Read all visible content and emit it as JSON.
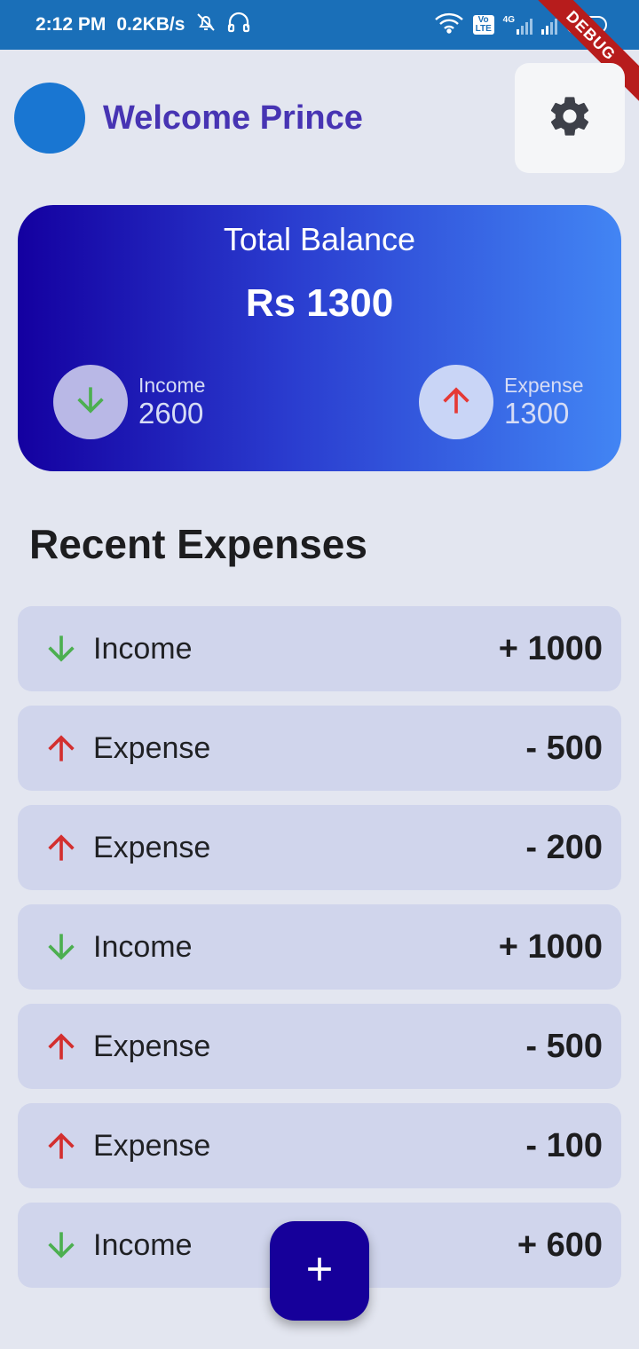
{
  "status_bar": {
    "time": "2:12 PM",
    "speed": "0.2KB/s",
    "battery": "63",
    "network_label": "4G",
    "volte_label": "Vo LTE",
    "debug_label": "DEBUG"
  },
  "header": {
    "welcome": "Welcome Prince",
    "avatar_color": "#1976d2",
    "settings_icon": "gear-icon"
  },
  "balance": {
    "title": "Total Balance",
    "amount": "Rs 1300",
    "income_label": "Income",
    "income_value": "2600",
    "expense_label": "Expense",
    "expense_value": "1300"
  },
  "recent": {
    "heading": "Recent Expenses",
    "items": [
      {
        "type": "income",
        "label": "Income",
        "amount": "+ 1000"
      },
      {
        "type": "expense",
        "label": "Expense",
        "amount": "- 500"
      },
      {
        "type": "expense",
        "label": "Expense",
        "amount": "- 200"
      },
      {
        "type": "income",
        "label": "Income",
        "amount": "+ 1000"
      },
      {
        "type": "expense",
        "label": "Expense",
        "amount": "- 500"
      },
      {
        "type": "expense",
        "label": "Expense",
        "amount": "- 100"
      },
      {
        "type": "income",
        "label": "Income",
        "amount": "+ 600"
      }
    ]
  },
  "colors": {
    "income_green": "#4caf50",
    "expense_red": "#d32f2f",
    "primary": "#16009a",
    "title_purple": "#4734b3"
  },
  "fab": {
    "icon": "plus-icon"
  }
}
